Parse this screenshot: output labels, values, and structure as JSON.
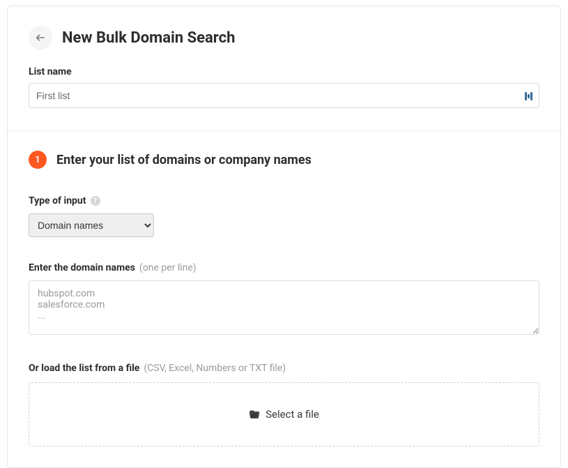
{
  "header": {
    "title": "New Bulk Domain Search"
  },
  "listName": {
    "label": "List name",
    "value": "First list"
  },
  "step1": {
    "number": "1",
    "title": "Enter your list of domains or company names",
    "typeLabel": "Type of input",
    "typeSelected": "Domain names",
    "domainsLabel": "Enter the domain names",
    "domainsHint": "(one per line)",
    "placeholder": "hubspot.com\nsalesforce.com\n...",
    "fileLabel": "Or load the list from a file",
    "fileHint": "(CSV, Excel, Numbers or TXT file)",
    "fileButton": "Select a file"
  }
}
